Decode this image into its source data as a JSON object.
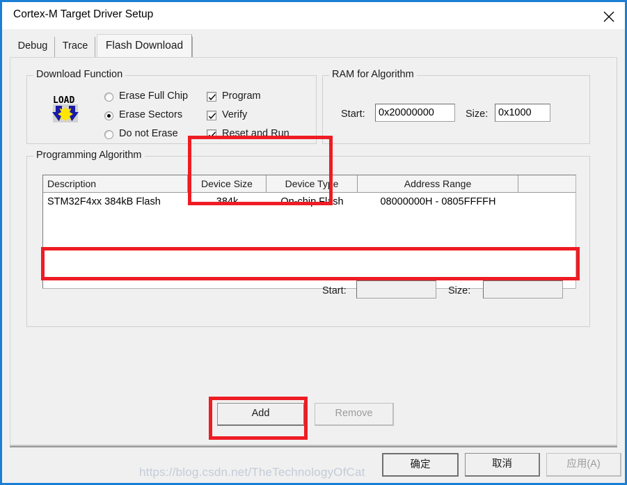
{
  "window": {
    "title": "Cortex-M Target Driver Setup",
    "close_icon": "close-icon",
    "frame_color": "#1a7fd4"
  },
  "tabs": [
    {
      "label": "Debug",
      "active": false
    },
    {
      "label": "Trace",
      "active": false
    },
    {
      "label": "Flash Download",
      "active": true
    }
  ],
  "download_function": {
    "legend": "Download Function",
    "icon": "load-icon",
    "radios": [
      {
        "label": "Erase Full Chip",
        "checked": false
      },
      {
        "label": "Erase Sectors",
        "checked": true
      },
      {
        "label": "Do not Erase",
        "checked": false
      }
    ],
    "checkboxes": [
      {
        "label": "Program",
        "checked": true
      },
      {
        "label": "Verify",
        "checked": true
      },
      {
        "label": "Reset and Run",
        "checked": true
      }
    ]
  },
  "ram_for_algorithm": {
    "legend": "RAM for Algorithm",
    "start_label": "Start:",
    "start_value": "0x20000000",
    "size_label": "Size:",
    "size_value": "0x1000"
  },
  "programming_algorithm": {
    "legend": "Programming Algorithm",
    "columns": [
      "Description",
      "Device Size",
      "Device Type",
      "Address Range",
      ""
    ],
    "rows": [
      {
        "description": "STM32F4xx 384kB Flash",
        "device_size": "384k",
        "device_type": "On-chip Flash",
        "address_range": "08000000H - 0805FFFFH",
        "extra": ""
      }
    ],
    "start_label": "Start:",
    "start_value": "",
    "size_label": "Size:",
    "size_value": ""
  },
  "buttons": {
    "add": "Add",
    "remove": "Remove",
    "ok": "确定",
    "cancel": "取消",
    "apply": "应用(A)"
  },
  "annotations": {
    "highlight_color": "#ee1c24",
    "regions": [
      "download-options-checkboxes",
      "flash-algorithm-row",
      "add-button"
    ]
  },
  "watermark": {
    "text": "https://blog.csdn.net/TheTechnologyOfCat"
  }
}
